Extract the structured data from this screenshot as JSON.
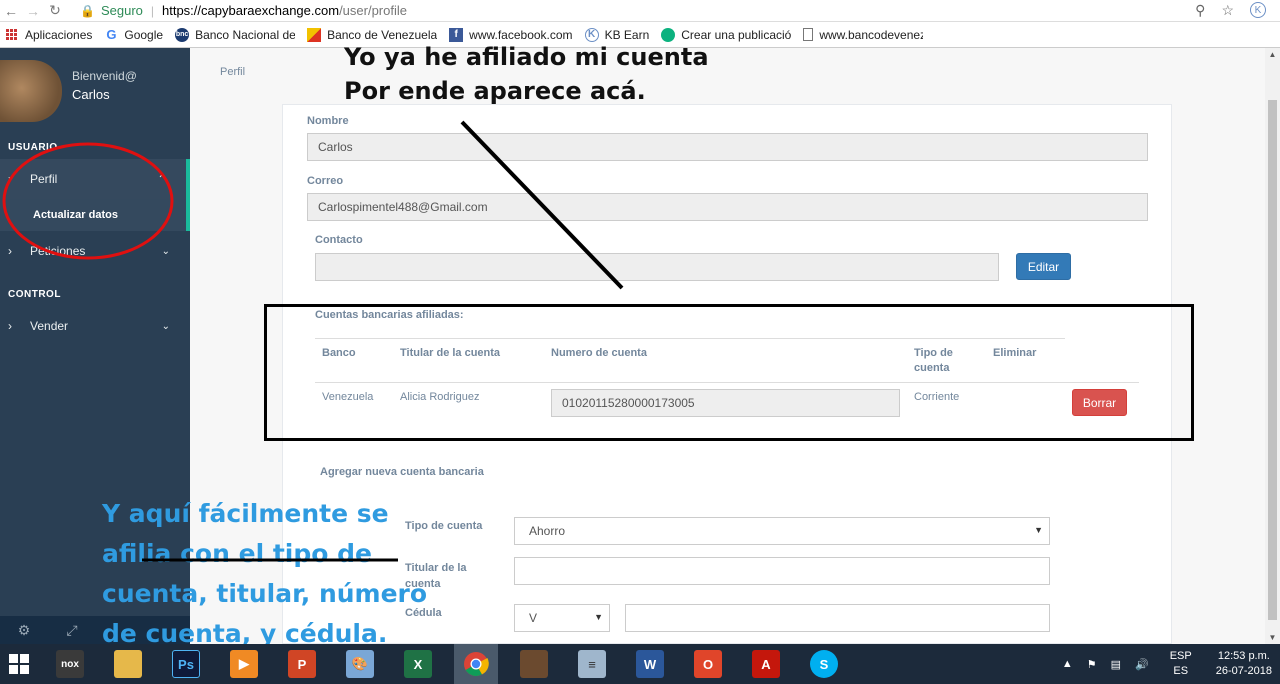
{
  "browser": {
    "secure_label": "Seguro",
    "url_host": "https://capybaraexchange.com",
    "url_path": "/user/profile"
  },
  "bookmarks": [
    {
      "label": "Aplicaciones",
      "icon": "apps-grid-icon"
    },
    {
      "label": "Google",
      "icon": "google-icon"
    },
    {
      "label": "Banco Nacional de C",
      "icon": "bnc-icon"
    },
    {
      "label": "Banco de Venezuela",
      "icon": "banco-venezuela-icon"
    },
    {
      "label": "www.facebook.com",
      "icon": "facebook-icon"
    },
    {
      "label": "KB Earn",
      "icon": "kb-icon"
    },
    {
      "label": "Crear una publicació",
      "icon": "steem-icon"
    },
    {
      "label": "www.bancodevenez",
      "icon": "page-icon"
    }
  ],
  "sidebar": {
    "greeting": "Bienvenid@",
    "user_name": "Carlos",
    "section_user": "USUARIO",
    "perfil": "Perfil",
    "actualizar": "Actualizar datos",
    "peticiones": "Peticiones",
    "section_control": "CONTROL",
    "vender": "Vender"
  },
  "main": {
    "breadcrumb": "Perfil",
    "nombre_label": "Nombre",
    "nombre_value": "Carlos",
    "correo_label": "Correo",
    "correo_value": "Carlospimentel488@Gmail.com",
    "contacto_label": "Contacto",
    "contacto_value": "",
    "editar_label": "Editar",
    "cuentas_title": "Cuentas bancarias afiliadas:",
    "table": {
      "headers": [
        "Banco",
        "Titular de la cuenta",
        "Numero de cuenta",
        "Tipo de cuenta",
        "Eliminar"
      ],
      "rows": [
        {
          "banco": "Venezuela",
          "titular": "Alicia Rodriguez",
          "numero": "01020115280000173005",
          "tipo": "Corriente",
          "borrar": "Borrar"
        }
      ]
    },
    "agregar_title": "Agregar nueva cuenta bancaria",
    "tipo_label": "Tipo de cuenta",
    "tipo_value": "Ahorro",
    "titular_label": "Titular de la cuenta",
    "cedula_label": "Cédula",
    "cedula_prefix": "V"
  },
  "annotations": {
    "top_line1": "Yo ya he afiliado mi cuenta",
    "top_line2": "Por ende aparece acá.",
    "bottom_line1": "Y aquí fácilmente se",
    "bottom_line2": "afilia con el tipo de",
    "bottom_line3": "cuenta, titular, número",
    "bottom_line4": "de cuenta, y cédula."
  },
  "taskbar": {
    "lang_top": "ESP",
    "lang_bottom": "ES",
    "time": "12:53 p.m.",
    "date": "26-07-2018"
  },
  "colors": {
    "sidebar_bg": "#2a3f54",
    "accent_teal": "#1abb9c",
    "primary_blue": "#337ab7",
    "danger_red": "#d9534f",
    "annotation_blue": "#2f9be0",
    "annotation_red": "#e01010"
  }
}
